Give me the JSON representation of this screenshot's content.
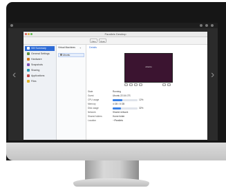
{
  "window": {
    "title": "Parallels Desktop"
  },
  "toolbar": {
    "buttons": [
      "New",
      "Open"
    ]
  },
  "sidebar": {
    "items": [
      {
        "label": "VM Summary",
        "color": "#2e6bd6"
      },
      {
        "label": "General Settings",
        "color": "#5a8f3c"
      },
      {
        "label": "Hardware",
        "color": "#d07a1d"
      },
      {
        "label": "Snapshots",
        "color": "#7b52b8"
      },
      {
        "label": "Sharing",
        "color": "#2a9bb5"
      },
      {
        "label": "Applications",
        "color": "#c04848"
      },
      {
        "label": "Files",
        "color": "#e0b52a"
      }
    ]
  },
  "midlist": {
    "header": "Virtual Machines",
    "selected": "Ubuntu"
  },
  "details": {
    "tab": "Details",
    "preview_logo": "ubuntu",
    "properties": [
      {
        "label": "State",
        "value": "Running"
      },
      {
        "label": "Guest",
        "value": "Ubuntu 22.04 LTS"
      },
      {
        "label": "CPU usage",
        "value": "12%"
      },
      {
        "label": "Memory",
        "value": "4 GB / 8 GB"
      },
      {
        "label": "Disk usage",
        "value": "32%"
      },
      {
        "label": "Network",
        "value": "Shared network"
      },
      {
        "label": "Shared folders",
        "value": "Home folder"
      },
      {
        "label": "Location",
        "value": "~/Parallels"
      }
    ],
    "cpu_level": 0.4,
    "disk_level": 0.32
  }
}
